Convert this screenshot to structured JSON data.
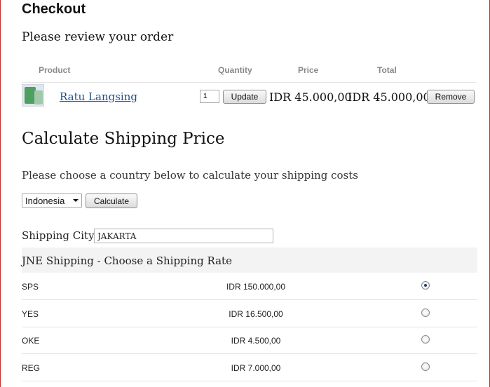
{
  "page": {
    "title": "Checkout",
    "subtitle": "Please review your order"
  },
  "order_table": {
    "headers": {
      "product": "Product",
      "quantity": "Quantity",
      "price": "Price",
      "total": "Total"
    },
    "rows": [
      {
        "product": "Ratu Langsing",
        "quantity": "1",
        "price": "IDR 45.000,00",
        "total": "IDR 45.000,00",
        "update_label": "Update",
        "remove_label": "Remove"
      }
    ]
  },
  "shipping": {
    "heading": "Calculate Shipping Price",
    "description": "Please choose a country below to calculate your shipping costs",
    "country": "Indonesia",
    "calculate_label": "Calculate",
    "city_label": "Shipping City:",
    "city_value": "JAKARTA",
    "rates_title": "JNE Shipping - Choose a Shipping Rate",
    "rates": [
      {
        "code": "SPS",
        "amount": "IDR 150.000,00",
        "selected": true
      },
      {
        "code": "YES",
        "amount": "IDR 16.500,00",
        "selected": false
      },
      {
        "code": "OKE",
        "amount": "IDR 4.500,00",
        "selected": false
      },
      {
        "code": "REG",
        "amount": "IDR 7.000,00",
        "selected": false
      }
    ]
  },
  "colors": {
    "frame_border": "#c0302a",
    "link": "#1a4d8f",
    "header_text": "#888888"
  }
}
